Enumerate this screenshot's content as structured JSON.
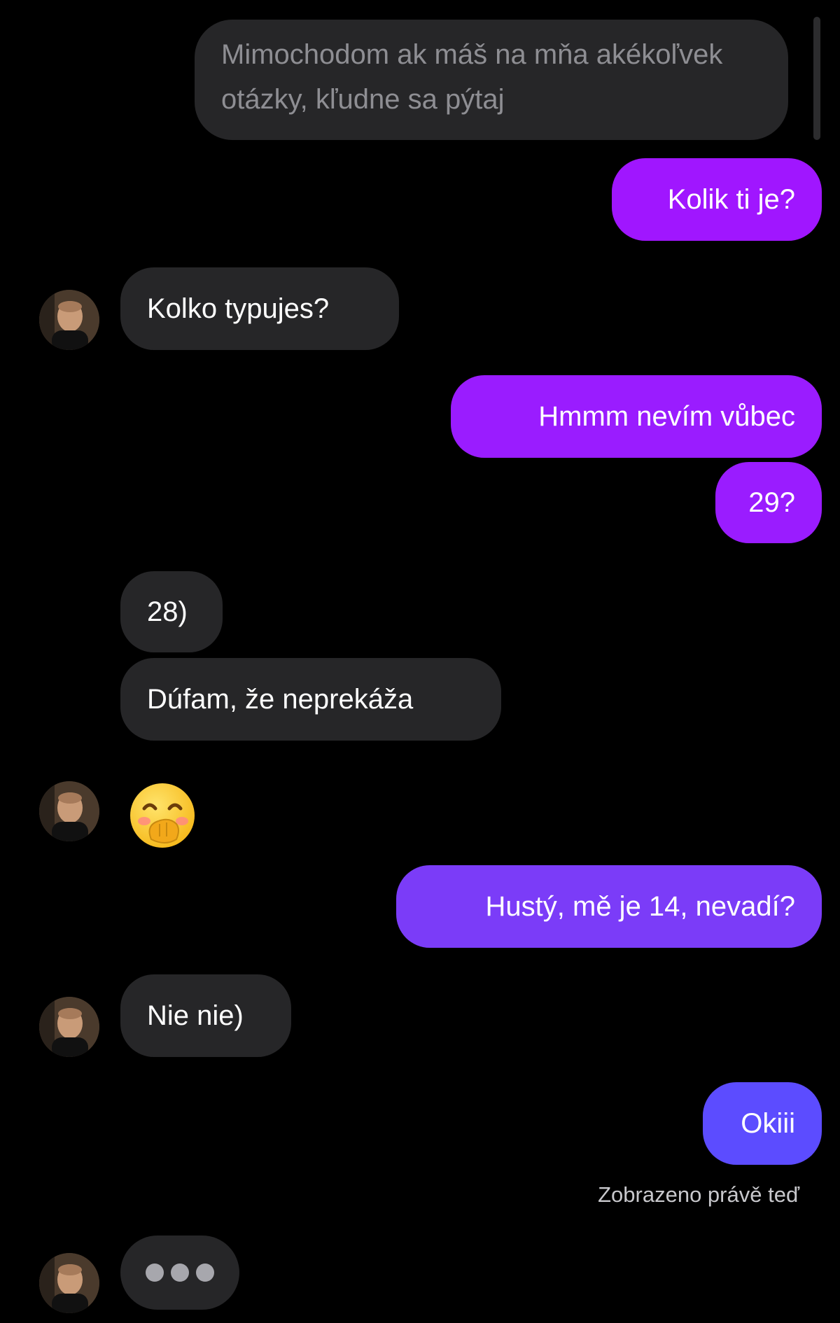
{
  "messages": {
    "m1": "Mimochodom ak máš na mňa akékoľvek otázky, kľudne sa pýtaj",
    "m2": "Kolik ti je?",
    "m3": "Kolko typujes?",
    "m4": "Hmmm nevím vůbec",
    "m5": "29?",
    "m6": "28)",
    "m7": "Dúfam, že neprekáža",
    "m8_emoji": "face-with-hand-over-mouth",
    "m9": "Hustý, mě je 14, nevadí?",
    "m10": "Nie nie)",
    "m11": "Okiii"
  },
  "status": {
    "seen": "Zobrazeno právě teď"
  },
  "icons": {
    "avatar": "contact-avatar",
    "typing": "typing-indicator"
  },
  "colors": {
    "background": "#000000",
    "incoming_bubble": "#262628",
    "outgoing_magenta": "#a016ff",
    "outgoing_violet": "#8a2cff",
    "outgoing_indigo": "#6e3cff",
    "outgoing_blue": "#5a46ff"
  }
}
